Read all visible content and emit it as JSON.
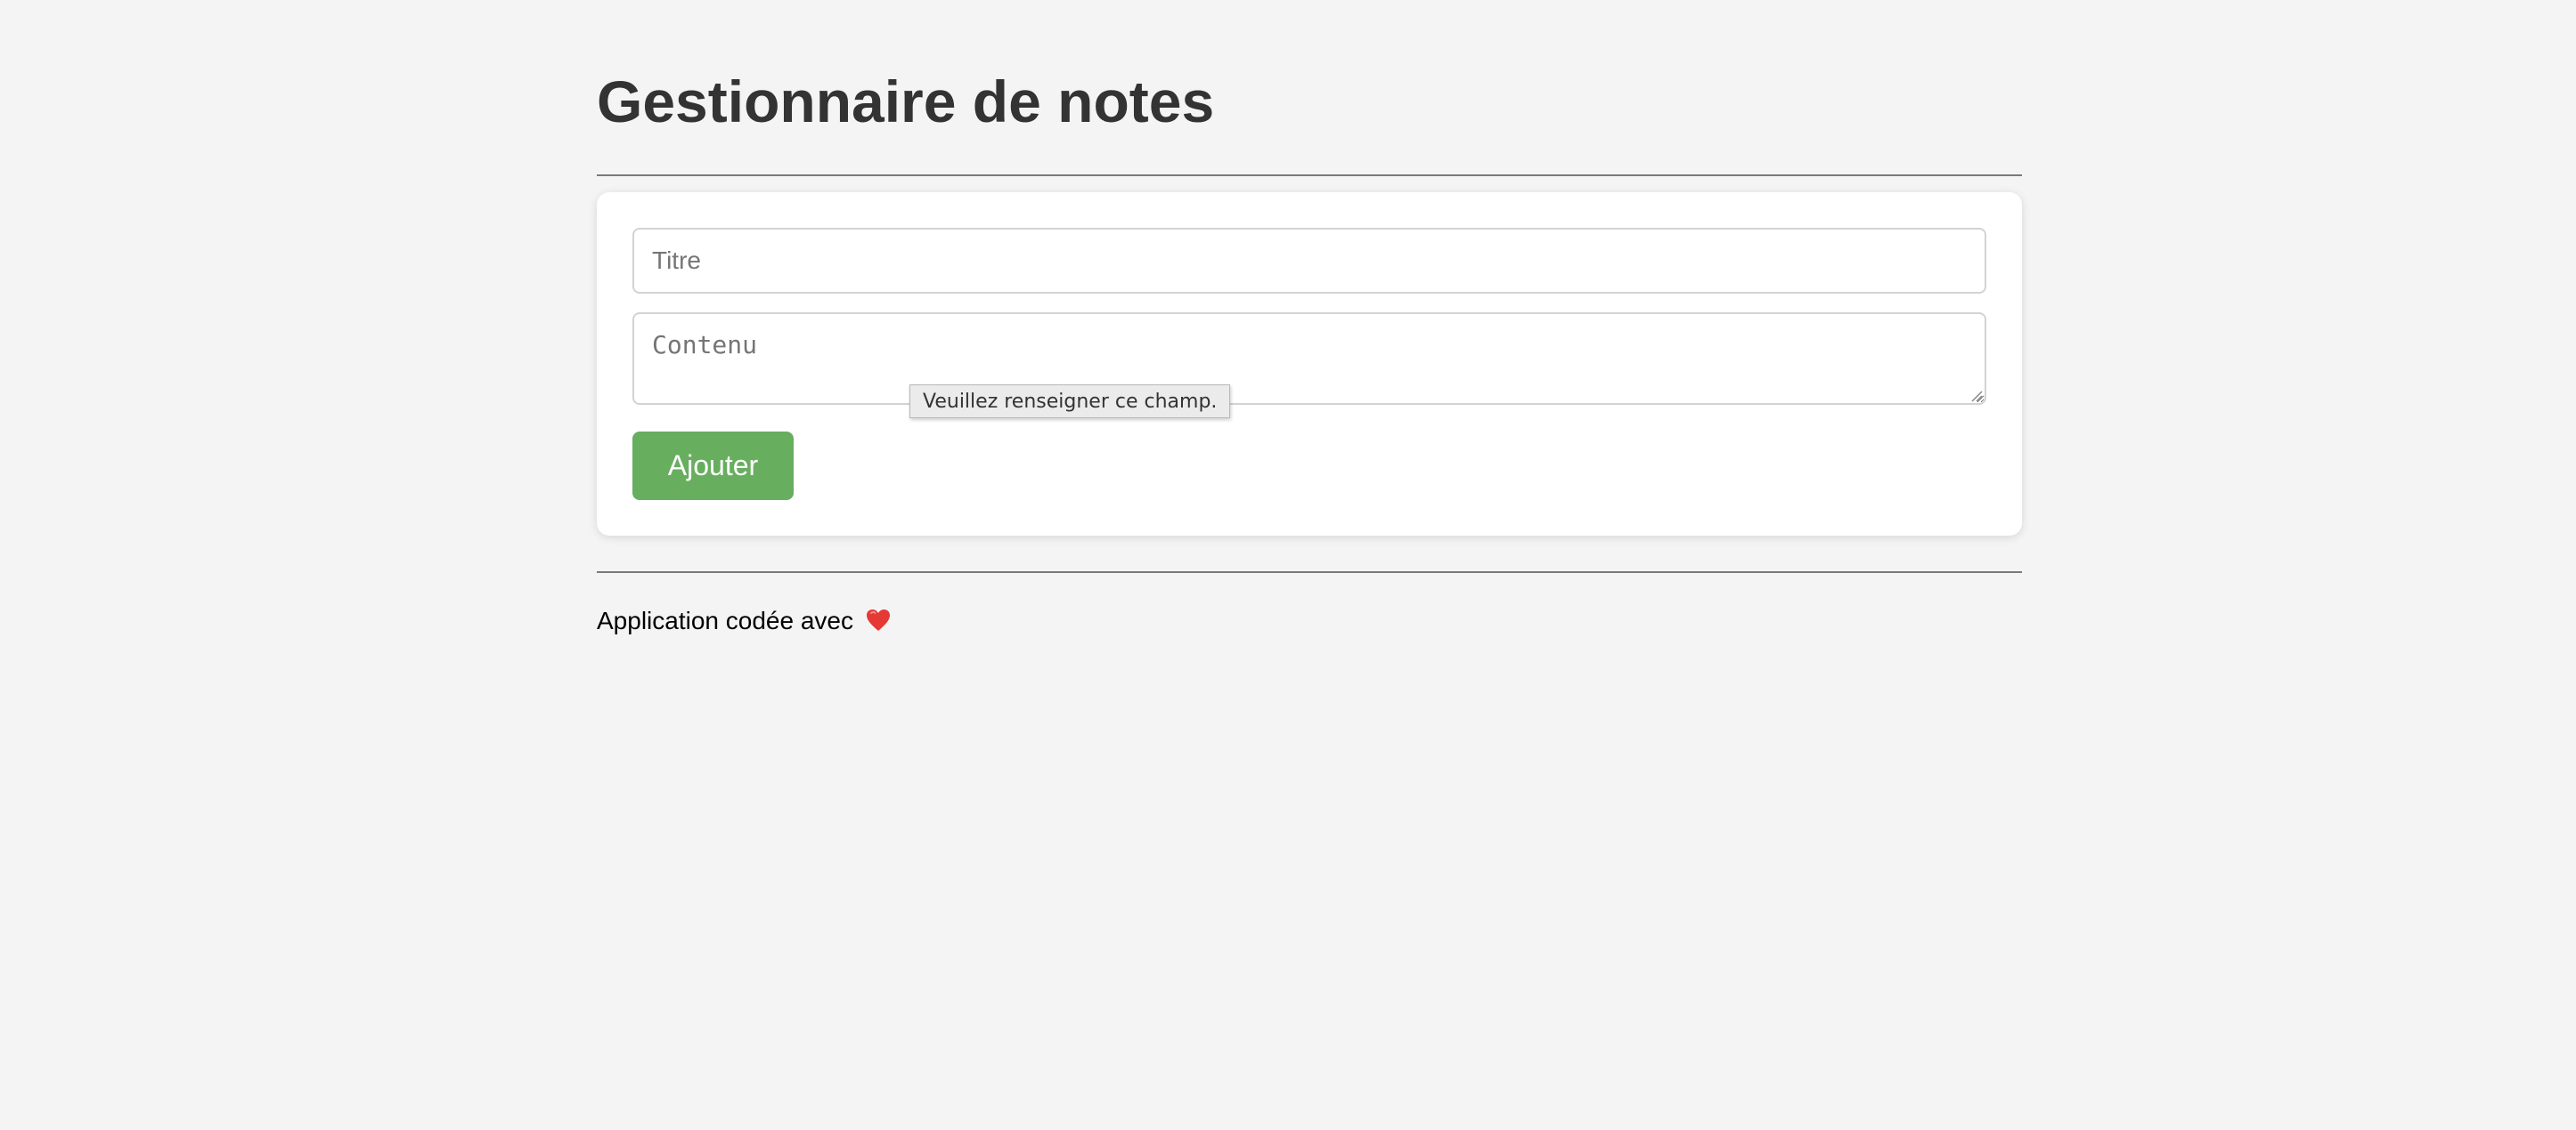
{
  "header": {
    "title": "Gestionnaire de notes"
  },
  "form": {
    "title_placeholder": "Titre",
    "title_value": "",
    "content_placeholder": "Contenu",
    "content_value": "",
    "add_label": "Ajouter",
    "validation_tooltip": "Veuillez renseigner ce champ."
  },
  "footer": {
    "text": "Application codée avec",
    "icon": "heart-icon"
  },
  "colors": {
    "background": "#f4f4f4",
    "title": "#333333",
    "button": "#67ae5f",
    "heart": "#e53935"
  }
}
